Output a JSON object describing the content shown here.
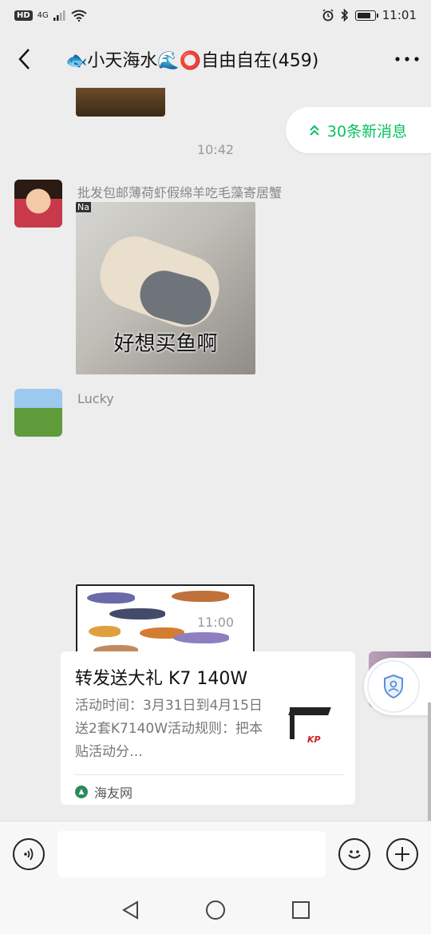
{
  "status_bar": {
    "left_badge": "HD",
    "signal_text": "4G",
    "time": "11:01",
    "battery_level": 0.8
  },
  "header": {
    "title": "🐟小天海水🌊⭕自由自在(459)",
    "back_icon": "chevron-left-icon",
    "more_icon": "more-dots-icon"
  },
  "new_messages": {
    "label": "30条新消息",
    "icon": "double-chevron-up-icon"
  },
  "messages": [
    {
      "type": "time",
      "text": "10:42"
    },
    {
      "type": "image",
      "sender": "批发包邮薄荷虾假绵羊吃毛藻寄居蟹",
      "image_caption": "好想买鱼啊",
      "image_tag": "Na"
    },
    {
      "type": "image",
      "sender": "Lucky"
    },
    {
      "type": "time",
      "text": "11:00"
    },
    {
      "type": "link_card",
      "title": "转发送大礼 K7 140W",
      "description": "活动时间：3月31日到4月15日送2套K7140W活动规则：把本贴活动分…",
      "thumb_logo": "KP",
      "source": "海友网"
    }
  ],
  "input_bar": {
    "placeholder": "",
    "voice_icon": "voice-icon",
    "emoji_icon": "emoji-icon",
    "plus_icon": "plus-icon"
  },
  "nav_bar": {
    "back_icon": "nav-back-icon",
    "home_icon": "nav-home-icon",
    "recent_icon": "nav-recent-icon"
  }
}
